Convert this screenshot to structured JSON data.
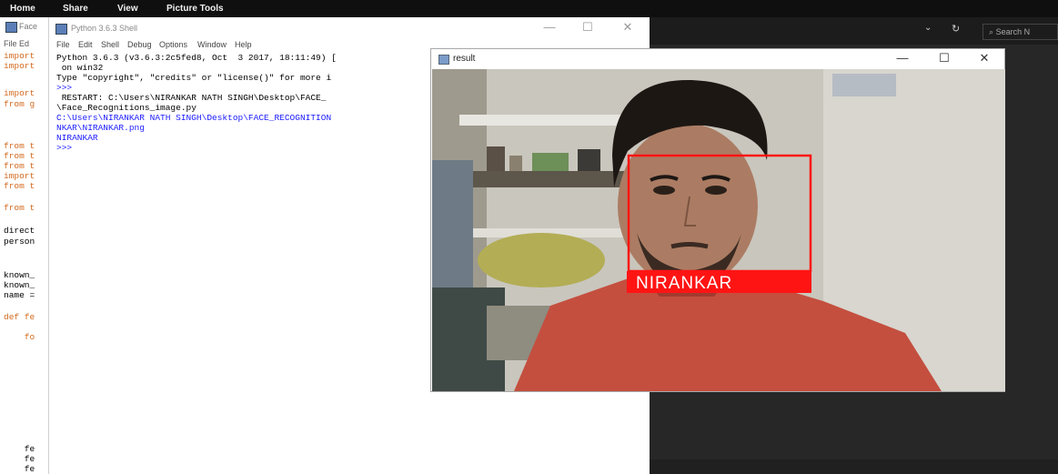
{
  "ribbon": {
    "tabs": [
      "Home",
      "Share",
      "View",
      "Picture Tools"
    ]
  },
  "explorer": {
    "search_placeholder": "Search N"
  },
  "editor": {
    "title": "Face",
    "menu": "File  Ed",
    "code_lines": [
      {
        "text": "import",
        "color": "orange"
      },
      {
        "text": "import",
        "color": "orange"
      },
      {
        "text": "",
        "color": "black"
      },
      {
        "text": "import",
        "color": "orange"
      },
      {
        "text": "from g",
        "color": "orange"
      },
      {
        "text": "",
        "color": "black"
      },
      {
        "text": "",
        "color": "black"
      },
      {
        "text": "from t",
        "color": "orange"
      },
      {
        "text": "from t",
        "color": "orange"
      },
      {
        "text": "from t",
        "color": "orange"
      },
      {
        "text": "import",
        "color": "orange"
      },
      {
        "text": "from t",
        "color": "orange"
      }
    ],
    "code_lines_2": [
      "from t",
      "",
      "direct",
      "person",
      "",
      "",
      "known_",
      "known_",
      "name ="
    ],
    "def_lines": [
      "def fe",
      "",
      "    fo"
    ],
    "bottom_lines": [
      "    fe",
      "    fe",
      "    fe"
    ]
  },
  "shell": {
    "title": "Python 3.6.3 Shell",
    "menu": [
      "File",
      "Edit",
      "Shell",
      "Debug",
      "Options",
      "Window",
      "Help"
    ],
    "lines": [
      {
        "text": "Python 3.6.3 (v3.6.3:2c5fed8, Oct  3 2017, 18:11:49) [",
        "cls": ""
      },
      {
        "text": " on win32",
        "cls": ""
      },
      {
        "text": "Type \"copyright\", \"credits\" or \"license()\" for more i",
        "cls": ""
      },
      {
        "text": ">>>",
        "cls": "blue"
      },
      {
        "text": " RESTART: C:\\Users\\NIRANKAR NATH SINGH\\Desktop\\FACE_",
        "cls": ""
      },
      {
        "text": "\\Face_Recognitions_image.py",
        "cls": ""
      },
      {
        "text": "C:\\Users\\NIRANKAR NATH SINGH\\Desktop\\FACE_RECOGNITION",
        "cls": "blue"
      },
      {
        "text": "NKAR\\NIRANKAR.png",
        "cls": "blue"
      },
      {
        "text": "NIRANKAR",
        "cls": "blue"
      },
      {
        "text": ">>> ",
        "cls": "blue"
      }
    ]
  },
  "result_window": {
    "title": "result",
    "face_label": "NIRANKAR",
    "box_color": "#ff1414"
  },
  "window_controls": {
    "minimize": "—",
    "maximize": "☐",
    "close": "✕"
  }
}
